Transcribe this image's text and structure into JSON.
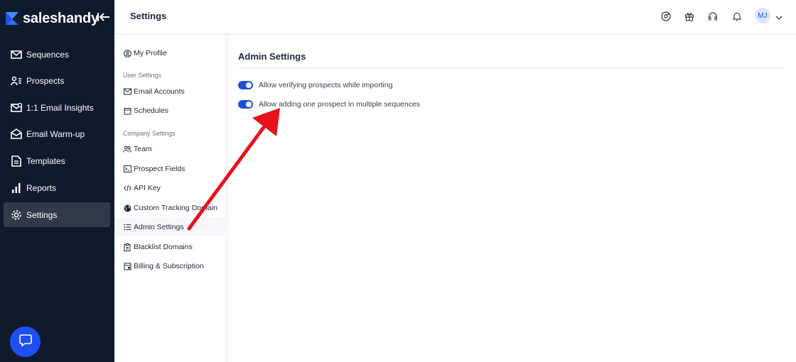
{
  "brand": {
    "name": "saleshandy"
  },
  "sidebar": {
    "items": [
      {
        "label": "Sequences",
        "icon": "mail-icon"
      },
      {
        "label": "Prospects",
        "icon": "prospects-icon"
      },
      {
        "label": "1:1 Email Insights",
        "icon": "email-insights-icon"
      },
      {
        "label": "Email Warm-up",
        "icon": "warmup-icon"
      },
      {
        "label": "Templates",
        "icon": "templates-icon"
      },
      {
        "label": "Reports",
        "icon": "reports-icon"
      },
      {
        "label": "Settings",
        "icon": "gear-icon",
        "active": true
      }
    ]
  },
  "header": {
    "title": "Settings",
    "avatar_initials": "MJ"
  },
  "subnav": {
    "my_profile": "My Profile",
    "user_section": "User Settings",
    "company_section": "Company Settings",
    "items": {
      "email_accounts": "Email Accounts",
      "schedules": "Schedules",
      "team": "Team",
      "prospect_fields": "Prospect Fields",
      "api_key": "API Key",
      "custom_tracking_domain": "Custom Tracking Domain",
      "admin_settings": "Admin Settings",
      "blacklist_domains": "Blacklist Domains",
      "billing": "Billing & Subscription"
    }
  },
  "main": {
    "title": "Admin Settings",
    "settings": [
      {
        "label": "Allow verifying prospects while importing",
        "enabled": true
      },
      {
        "label": "Allow adding one prospect in multiple sequences",
        "enabled": true
      }
    ]
  },
  "colors": {
    "sidebar_bg": "#0f1a2c",
    "accent": "#1d4ed8",
    "annotation_arrow": "#e8111c"
  }
}
